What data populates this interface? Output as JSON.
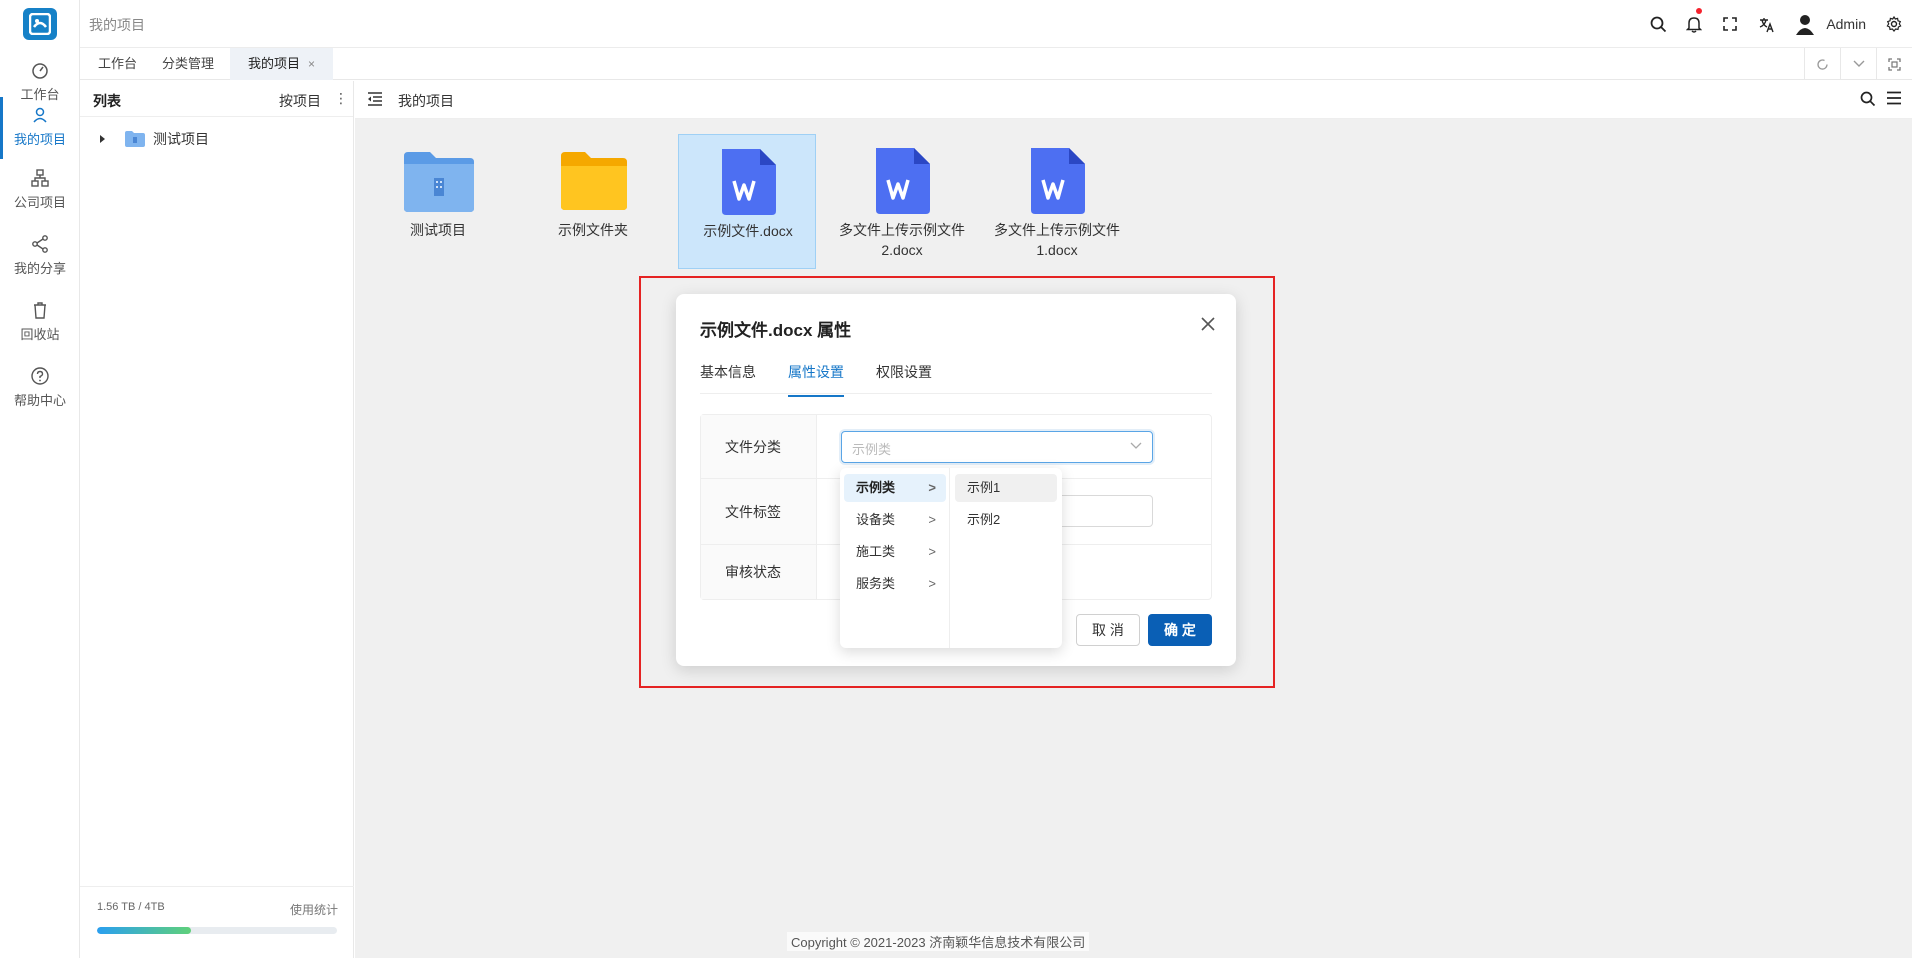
{
  "app": {
    "breadcrumb": "我的项目"
  },
  "rail": {
    "items": [
      {
        "label": "工作台",
        "icon": "dashboard-icon"
      },
      {
        "label": "我的项目",
        "icon": "user-icon"
      },
      {
        "label": "公司项目",
        "icon": "org-chart-icon"
      },
      {
        "label": "我的分享",
        "icon": "share-icon"
      },
      {
        "label": "回收站",
        "icon": "trash-icon"
      },
      {
        "label": "帮助中心",
        "icon": "help-icon"
      }
    ]
  },
  "topbar": {
    "user": "Admin"
  },
  "tabs": [
    {
      "label": "工作台"
    },
    {
      "label": "分类管理"
    },
    {
      "label": "我的项目",
      "close": "×"
    }
  ],
  "panel": {
    "title": "列表",
    "group_by": "按项目",
    "more": "⋮",
    "tree": [
      "测试项目"
    ],
    "storage_used": "1.56 TB / 4TB",
    "usage_link": "使用统计",
    "usage_fraction": 0.39
  },
  "content": {
    "title": "我的项目",
    "files": [
      {
        "name": "测试项目",
        "type": "project-folder"
      },
      {
        "name": "示例文件夹",
        "type": "folder"
      },
      {
        "name": "示例文件.docx",
        "type": "word",
        "selected": true
      },
      {
        "name": "多文件上传示例文件2.docx",
        "type": "word"
      },
      {
        "name": "多文件上传示例文件1.docx",
        "type": "word"
      }
    ],
    "copyright": "Copyright © 2021-2023 济南颖华信息技术有限公司"
  },
  "modal": {
    "title": "示例文件.docx 属性",
    "tabs": [
      "基本信息",
      "属性设置",
      "权限设置"
    ],
    "fields": {
      "category_label": "文件分类",
      "category_placeholder": "示例类",
      "tags_label": "文件标签",
      "review_label": "审核状态"
    },
    "cancel": "取 消",
    "ok": "确 定"
  },
  "cascader": {
    "level1": [
      "示例类",
      "设备类",
      "施工类",
      "服务类"
    ],
    "level2": [
      "示例1",
      "示例2"
    ]
  },
  "colors": {
    "primary": "#1677c8",
    "confirm": "#0a5fb5",
    "highlight": "#e52323"
  }
}
